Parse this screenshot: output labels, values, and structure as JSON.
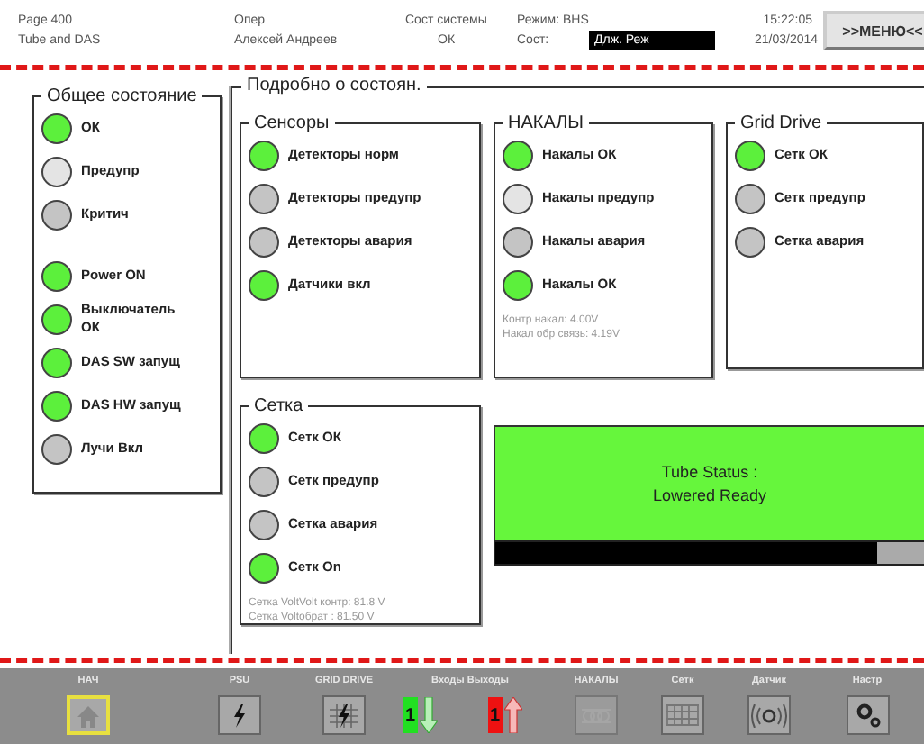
{
  "header": {
    "page": "Page 400",
    "screen": "Tube and DAS",
    "operator_label": "Опер",
    "operator": "Алексей Андреев",
    "system_label": "Сост системы",
    "system_status": "ОК",
    "mode": "Режим: BHS",
    "state_label": "Сост:",
    "state": "Длж. Реж",
    "time": "15:22:05",
    "date": "21/03/2014",
    "menu_button": ">>МЕНЮ<<"
  },
  "general": {
    "title": "Общее состояние",
    "lamp_groups": [
      [
        {
          "label": "ОК",
          "color": "#5cf03c"
        },
        {
          "label": "Предупр",
          "color": "#e4e4e4"
        },
        {
          "label": "Критич",
          "color": "#c4c4c4"
        }
      ],
      [
        {
          "label": "Power ON",
          "color": "#5cf03c"
        },
        {
          "label": "Выключатель ОК",
          "color": "#5cf03c"
        },
        {
          "label": "DAS SW запущ",
          "color": "#5cf03c"
        },
        {
          "label": "DAS HW запущ",
          "color": "#5cf03c"
        },
        {
          "label": "Лучи Вкл",
          "color": "#c4c4c4"
        }
      ]
    ]
  },
  "detail": {
    "title": "Подробно о состоян.",
    "groups": [
      {
        "title": "Сенсоры",
        "lamps": [
          {
            "label": "Детекторы норм",
            "color": "#5cf03c"
          },
          {
            "label": "Детекторы предупр",
            "color": "#c4c4c4"
          },
          {
            "label": "Детекторы авария",
            "color": "#c4c4c4"
          },
          {
            "label": "Датчики вкл",
            "color": "#5cf03c"
          }
        ]
      },
      {
        "title": "НАКАЛЫ",
        "lamps": [
          {
            "label": "Накалы ОК",
            "color": "#5cf03c"
          },
          {
            "label": "Накалы предупр",
            "color": "#e4e4e4"
          },
          {
            "label": "Накалы авария",
            "color": "#c4c4c4"
          },
          {
            "label": "Накалы ОК",
            "color": "#5cf03c"
          }
        ],
        "readouts": [
          "Контр накал: 4.00V",
          "Накал обр связь: 4.19V"
        ]
      },
      {
        "title": "Grid Drive",
        "lamps": [
          {
            "label": "Сетк ОК",
            "color": "#5cf03c"
          },
          {
            "label": "Сетк предупр",
            "color": "#c4c4c4"
          },
          {
            "label": "Сетка авария",
            "color": "#c4c4c4"
          }
        ]
      },
      {
        "title": "Сетка",
        "lamps": [
          {
            "label": "Сетк ОК",
            "color": "#5cf03c"
          },
          {
            "label": "Сетк предупр",
            "color": "#c4c4c4"
          },
          {
            "label": "Сетка авария",
            "color": "#c4c4c4"
          },
          {
            "label": "Сетк On",
            "color": "#5cf03c"
          }
        ],
        "readouts": [
          "Сетка VoltVolt контр: 81.8 V",
          "Сетка Voltобрат : 81.50 V"
        ]
      }
    ]
  },
  "tube_status": {
    "lines": [
      "Tube Status :",
      "Lowered Ready"
    ],
    "level": 0.89
  },
  "nav": [
    {
      "label": "НАЧ",
      "kind": "home",
      "selected": true,
      "disabled": false
    },
    {
      "label": "PSU",
      "kind": "bolt",
      "selected": false,
      "disabled": false
    },
    {
      "label": "GRID DRIVE",
      "kind": "grid-bolt",
      "selected": false,
      "disabled": false
    },
    {
      "label": "Входы Выходы",
      "kind": "input",
      "badge": "1",
      "selected": false,
      "disabled": false
    },
    {
      "kind": "output",
      "badge": "1",
      "selected": false,
      "disabled": false
    },
    {
      "label": "НАКАЛЫ",
      "kind": "coil",
      "selected": false,
      "disabled": true
    },
    {
      "label": "Сетк",
      "kind": "mesh",
      "selected": false,
      "disabled": false
    },
    {
      "label": "Датчик",
      "kind": "sensor",
      "selected": false,
      "disabled": false
    },
    {
      "label": "Настр",
      "kind": "gears",
      "selected": false,
      "disabled": false
    }
  ]
}
